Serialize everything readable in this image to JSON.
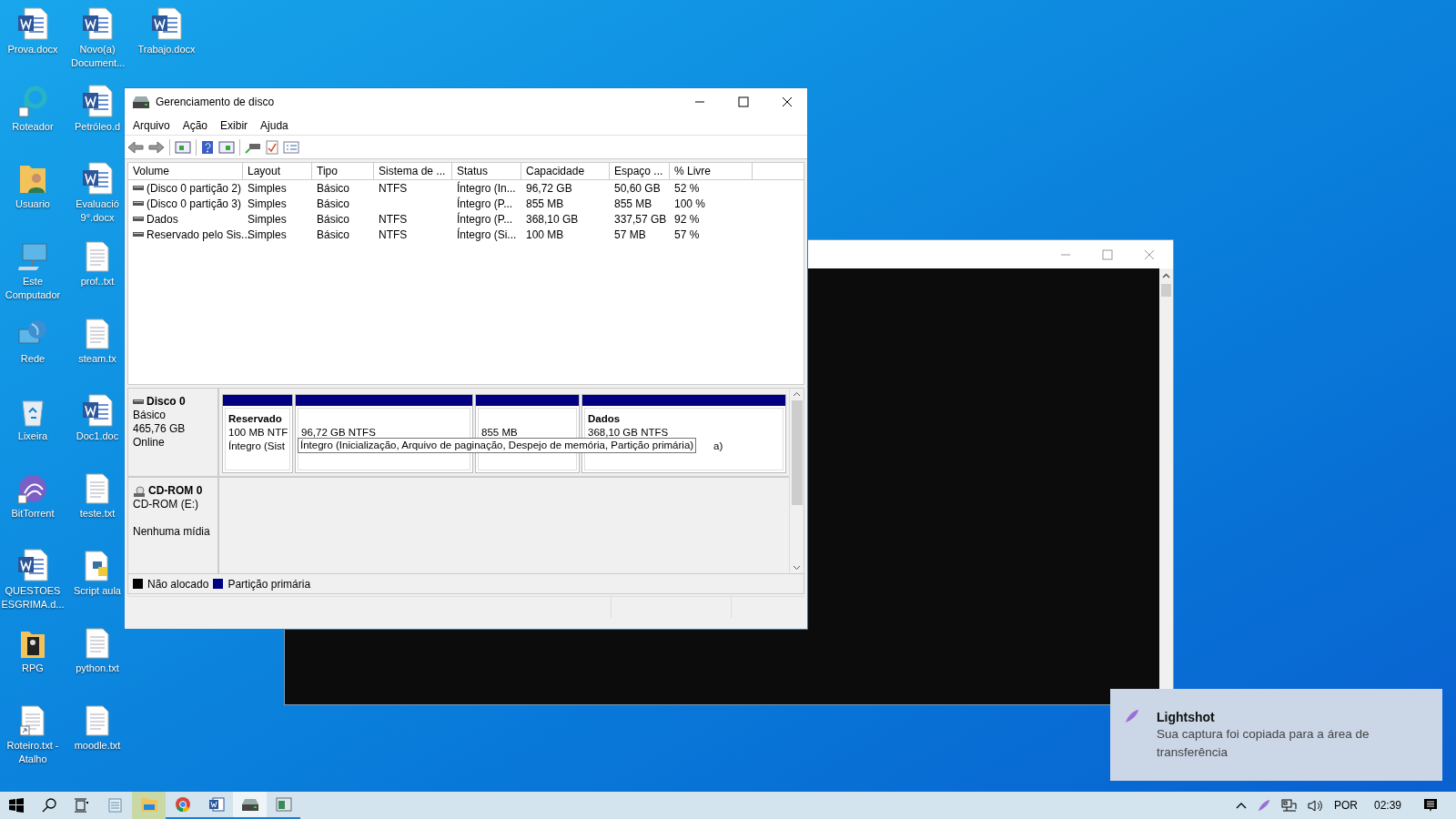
{
  "desktop_icons": [
    {
      "label": "Prova.docx",
      "kind": "word"
    },
    {
      "label": "Roteador",
      "kind": "router"
    },
    {
      "label": "Usuario",
      "kind": "user"
    },
    {
      "label": "Este Computador",
      "kind": "computer"
    },
    {
      "label": "Rede",
      "kind": "network"
    },
    {
      "label": "Lixeira",
      "kind": "bin"
    },
    {
      "label": "BitTorrent",
      "kind": "torrent"
    },
    {
      "label": "QUESTOES ESGRIMA.d...",
      "kind": "word"
    },
    {
      "label": "RPG",
      "kind": "folder"
    },
    {
      "label": "Roteiro.txt - Atalho",
      "kind": "shortcut"
    },
    {
      "label": "Novo(a) Document...",
      "kind": "word"
    },
    {
      "label": "Petróleo.d",
      "kind": "word"
    },
    {
      "label": "Evaluació 9°.docx",
      "kind": "word"
    },
    {
      "label": "prof..txt",
      "kind": "text"
    },
    {
      "label": "steam.tx",
      "kind": "text"
    },
    {
      "label": "Doc1.doc",
      "kind": "word"
    },
    {
      "label": "teste.txt",
      "kind": "text"
    },
    {
      "label": "Script aula",
      "kind": "python"
    },
    {
      "label": "python.txt",
      "kind": "text"
    },
    {
      "label": "moodle.txt",
      "kind": "text"
    },
    {
      "label": "Trabajo.docx",
      "kind": "word"
    }
  ],
  "window": {
    "title": "Gerenciamento de disco",
    "menu": [
      "Arquivo",
      "Ação",
      "Exibir",
      "Ajuda"
    ],
    "volume_list": {
      "columns": [
        "Volume",
        "Layout",
        "Tipo",
        "Sistema de ...",
        "Status",
        "Capacidade",
        "Espaço ...",
        "% Livre"
      ],
      "rows": [
        [
          "(Disco 0 partição 2)",
          "Simples",
          "Básico",
          "NTFS",
          "Íntegro (In...",
          "96,72 GB",
          "50,60 GB",
          "52 %"
        ],
        [
          "(Disco 0 partição 3)",
          "Simples",
          "Básico",
          "",
          "Íntegro (P...",
          "855 MB",
          "855 MB",
          "100 %"
        ],
        [
          "Dados",
          "Simples",
          "Básico",
          "NTFS",
          "Íntegro (P...",
          "368,10 GB",
          "337,57 GB",
          "92 %"
        ],
        [
          "Reservado pelo Sis...",
          "Simples",
          "Básico",
          "NTFS",
          "Íntegro (Si...",
          "100 MB",
          "57 MB",
          "57 %"
        ]
      ]
    },
    "disks": [
      {
        "kind": "disk",
        "name": "Disco 0",
        "type": "Básico",
        "size": "465,76 GB",
        "state": "Online",
        "partitions": [
          {
            "name": "Reservado",
            "size": "100 MB NTF",
            "status": "Íntegro (Sist"
          },
          {
            "size": "96,72 GB NTFS"
          },
          {
            "size": "855 MB"
          },
          {
            "name": "Dados",
            "size": "368,10 GB NTFS",
            "status": "a)"
          }
        ]
      },
      {
        "kind": "cdrom",
        "name": "CD-ROM 0",
        "type": "CD-ROM (E:)",
        "state": "Nenhuma mídia"
      }
    ],
    "tooltip": "Íntegro (Inicialização, Arquivo de paginação, Despejo de memória, Partição primária)",
    "legend": [
      {
        "label": "Não alocado",
        "color": "#000000"
      },
      {
        "label": "Partição primária",
        "color": "#000080"
      }
    ]
  },
  "taskbar": {
    "apps": [
      {
        "kind": "notepad",
        "running": false,
        "active": false,
        "hovered": false
      },
      {
        "kind": "explorer",
        "running": false,
        "active": false,
        "hovered": true
      },
      {
        "kind": "chrome",
        "running": true,
        "active": false,
        "hovered": false
      },
      {
        "kind": "word",
        "running": true,
        "active": false,
        "hovered": false
      },
      {
        "kind": "disk",
        "running": true,
        "active": true,
        "hovered": false
      },
      {
        "kind": "window",
        "running": true,
        "active": false,
        "hovered": false
      }
    ],
    "language": "POR",
    "time": "02:39"
  },
  "notification": {
    "app": "Lightshot",
    "message": "Sua captura foi copiada para a área de transferência"
  }
}
